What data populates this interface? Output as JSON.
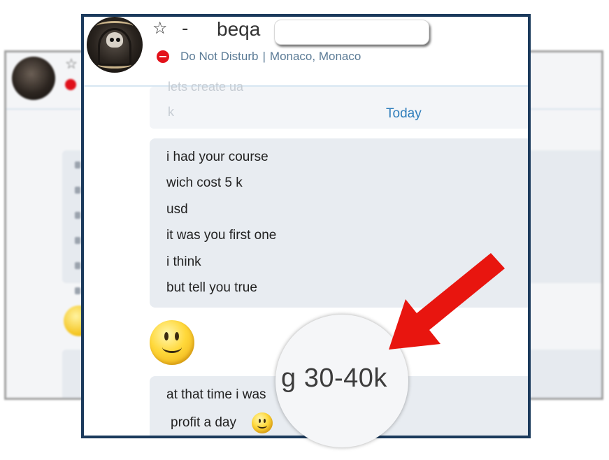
{
  "window": {
    "contact_name": "beqa",
    "name_prefix": "-",
    "status": "Do Not Disturb",
    "status_separator": "|",
    "location": "Monaco, Monaco"
  },
  "chat": {
    "faded_messages": [
      "lets create ua",
      "k"
    ],
    "date_separator": "Today",
    "message_group_1": [
      "i had your course",
      "wich cost 5 k",
      "usd",
      "it was you first one",
      "i think",
      "but tell you true"
    ],
    "message_group_2": [
      "at that time i was",
      "profit a day"
    ]
  },
  "callout": {
    "magnified_text": "g 30-40k",
    "arrow_color": "#e8150f"
  },
  "colors": {
    "frame_border": "#1b3a5c",
    "bubble_bg": "#e8ecf1",
    "status_text": "#5a7a95",
    "today_text": "#2e7dbb",
    "dnd_red": "#e3111a"
  },
  "icons": {
    "favorite": "star-outline-icon",
    "presence": "do-not-disturb-icon",
    "emoticon": "smiley-icon"
  }
}
